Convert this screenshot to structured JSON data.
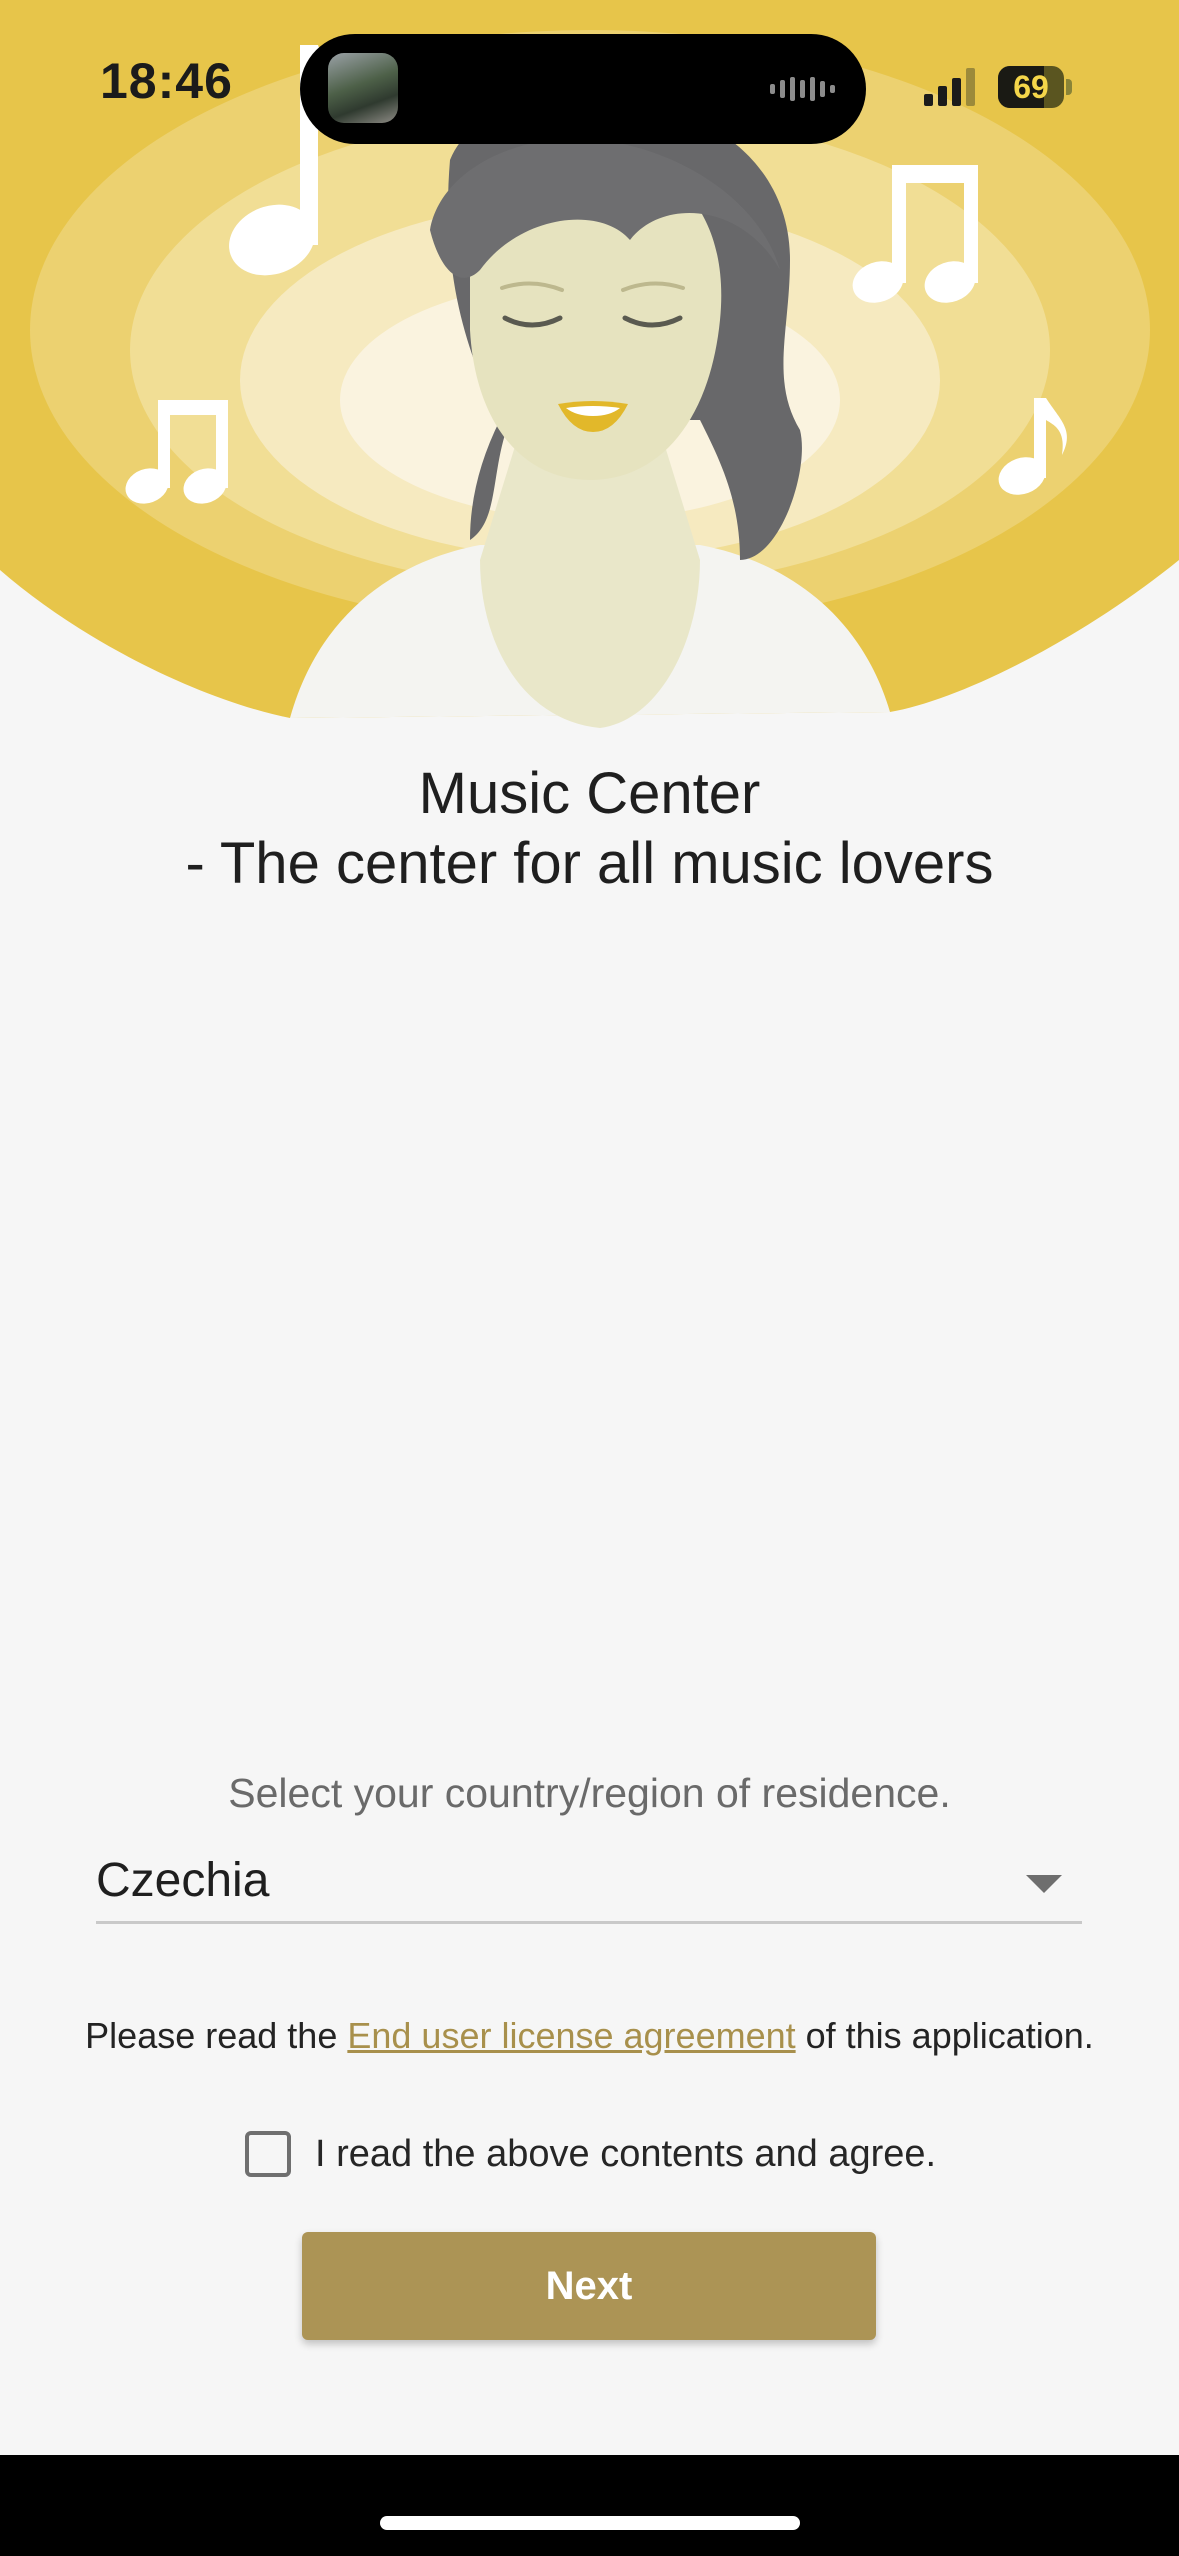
{
  "status_bar": {
    "time": "18:46",
    "battery_level": "69",
    "battery_fraction": 0.69,
    "signal_bars": 3,
    "icons": [
      "signal-icon",
      "battery-icon",
      "audio-waveform-icon"
    ]
  },
  "hero": {
    "colors": {
      "outer": "#e7c54a",
      "ring_2": "#ecd170",
      "ring_3": "#f1de95",
      "ring_4": "#f6eac0",
      "inner": "#faf3df"
    },
    "icons": [
      "music-note-icon",
      "beamed-notes-icon",
      "singing-woman-illustration"
    ]
  },
  "title": {
    "line1": "Music Center",
    "line2": "- The center for all music lovers"
  },
  "country": {
    "prompt": "Select your country/region of residence.",
    "selected": "Czechia"
  },
  "eula": {
    "prefix": "Please read the ",
    "link": "End user license agreement",
    "suffix": " of this application."
  },
  "agree": {
    "label": "I read the above contents and agree.",
    "checked": false
  },
  "next_button": {
    "label": "Next",
    "color": "#ac9455"
  }
}
